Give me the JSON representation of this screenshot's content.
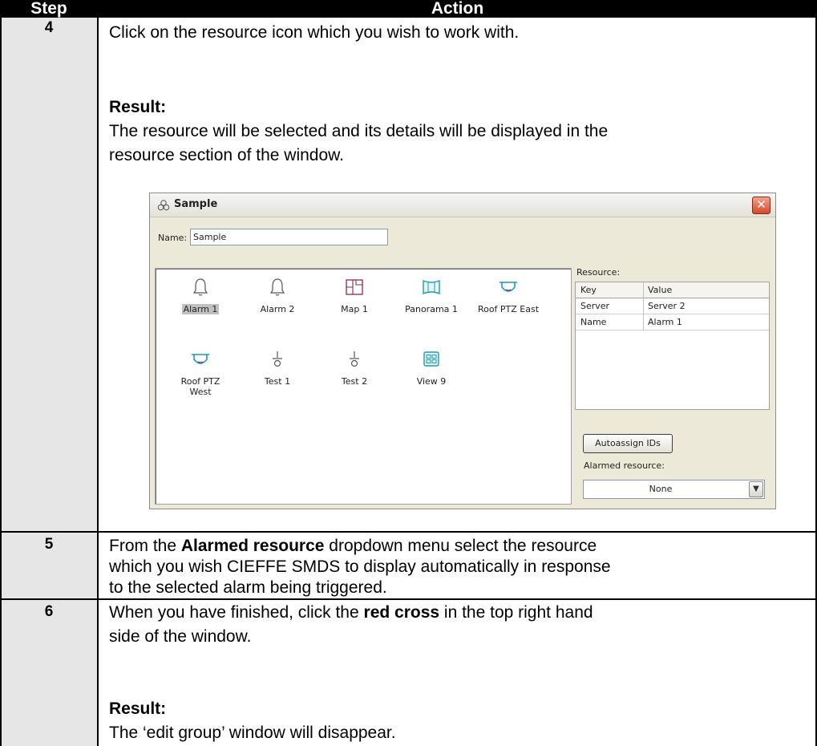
{
  "table": {
    "headers": {
      "step": "Step",
      "action": "Action"
    },
    "rows": [
      {
        "step": "4",
        "instruction": "Click on the resource icon which you wish to work with.",
        "result_label": "Result:",
        "result_line1": "The resource will be selected and its details will be displayed in the",
        "result_line2": "resource section of the window."
      },
      {
        "step": "5",
        "line1_pre": "From the ",
        "line1_bold": "Alarmed resource",
        "line1_post": " dropdown menu select the resource",
        "line2": "which you wish CIEFFE SMDS to display automatically in response",
        "line3": "to the selected alarm being triggered."
      },
      {
        "step": "6",
        "line1_pre": "When you have finished, click the ",
        "line1_bold": "red cross",
        "line1_post": " in the top right hand",
        "line2": "side of the window.",
        "result_label": "Result:",
        "result_line1": "The ‘edit group’ window will disappear."
      }
    ]
  },
  "dialog": {
    "title": "Sample",
    "close_symbol": "✕",
    "name_label": "Name:",
    "name_value": "Sample",
    "resource_label": "Resource:",
    "kv_headers": {
      "key": "Key",
      "value": "Value"
    },
    "kv_rows": [
      {
        "key": "Server",
        "value": "Server 2"
      },
      {
        "key": "Name",
        "value": "Alarm 1"
      }
    ],
    "autoassign_label": "Autoassign IDs",
    "alarmed_label": "Alarmed resource:",
    "alarmed_value": "None",
    "dropdown_arrow": "▼",
    "resources": [
      {
        "label": "Alarm 1",
        "icon": "bell-icon",
        "selected": true
      },
      {
        "label": "Alarm 2",
        "icon": "bell-icon",
        "selected": false
      },
      {
        "label": "Map 1",
        "icon": "map-icon",
        "selected": false
      },
      {
        "label": "Panorama 1",
        "icon": "panorama-icon",
        "selected": false
      },
      {
        "label": "Roof PTZ East",
        "icon": "ptz-camera-icon",
        "selected": false
      },
      {
        "label": "Roof PTZ",
        "label2": "West",
        "icon": "ptz-camera-icon",
        "selected": false
      },
      {
        "label": "Test 1",
        "icon": "switch-icon",
        "selected": false
      },
      {
        "label": "Test 2",
        "icon": "switch-icon",
        "selected": false
      },
      {
        "label": "View 9",
        "icon": "view-grid-icon",
        "selected": false
      }
    ]
  },
  "colors": {
    "header_bg": "#000000",
    "step_column_bg": "#e6e6e6",
    "dialog_bg": "#ece9d8",
    "close_button": "#d5482a",
    "icon_teal": "#1a9bb6",
    "icon_magenta": "#8c2a55"
  }
}
